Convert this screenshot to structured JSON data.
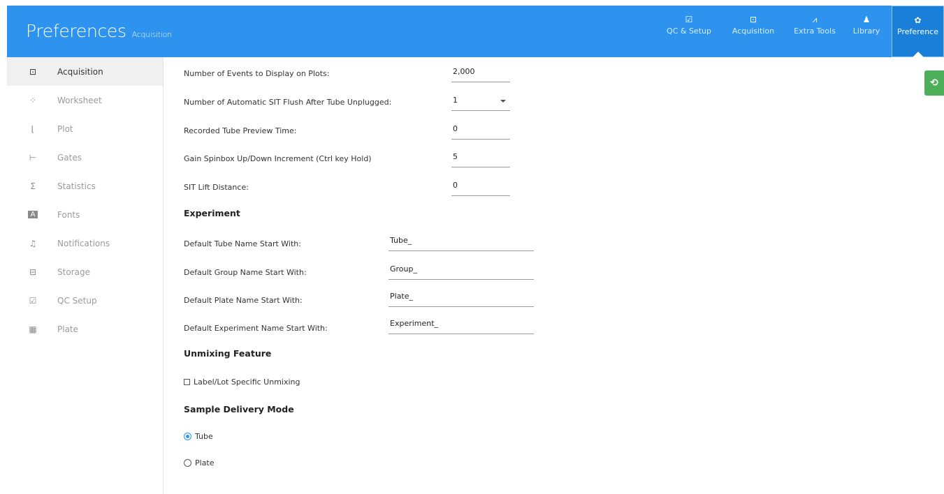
{
  "header": {
    "title": "Preferences",
    "subtitle": "Acquisition"
  },
  "topnav": [
    {
      "label": "QC & Setup",
      "icon": "qc-setup-icon",
      "glyph": "☑"
    },
    {
      "label": "Acquisition",
      "icon": "acquisition-icon",
      "glyph": "⊡"
    },
    {
      "label": "Extra Tools",
      "icon": "extra-tools-icon",
      "glyph": "⩘"
    },
    {
      "label": "Library",
      "icon": "library-icon",
      "glyph": "♟"
    },
    {
      "label": "Preference",
      "icon": "gear-icon",
      "glyph": "✿"
    }
  ],
  "sidebar": {
    "items": [
      {
        "label": "Acquisition",
        "glyph": "⊡"
      },
      {
        "label": "Worksheet",
        "glyph": "⁘"
      },
      {
        "label": "Plot",
        "glyph": "⌊"
      },
      {
        "label": "Gates",
        "glyph": "⊢"
      },
      {
        "label": "Statistics",
        "glyph": "Σ"
      },
      {
        "label": "Fonts",
        "glyph": "A"
      },
      {
        "label": "Notifications",
        "glyph": "♫"
      },
      {
        "label": "Storage",
        "glyph": "⊟"
      },
      {
        "label": "QC Setup",
        "glyph": "☑"
      },
      {
        "label": "Plate",
        "glyph": "▦"
      }
    ]
  },
  "acquisition": {
    "events_label": "Number of Events to Display on Plots:",
    "events_value": "2,000",
    "flush_label": "Number of Automatic SIT Flush After Tube Unplugged:",
    "flush_value": "1",
    "preview_label": "Recorded Tube Preview Time:",
    "preview_value": "0",
    "gain_label": "Gain Spinbox Up/Down Increment (Ctrl key Hold)",
    "gain_value": "5",
    "sit_label": "SIT Lift Distance:",
    "sit_value": "0"
  },
  "experiment": {
    "heading": "Experiment",
    "tube_label": "Default Tube Name Start With:",
    "tube_value": "Tube_",
    "group_label": "Default Group Name Start With:",
    "group_value": "Group_",
    "plate_label": "Default Plate Name Start With:",
    "plate_value": "Plate_",
    "exp_label": "Default Experiment Name Start With:",
    "exp_value": "Experiment_"
  },
  "unmixing": {
    "heading": "Unmixing Feature",
    "checkbox_label": "Label/Lot Specific Unmixing"
  },
  "delivery": {
    "heading": "Sample Delivery Mode",
    "tube_label": "Tube",
    "plate_label": "Plate"
  }
}
